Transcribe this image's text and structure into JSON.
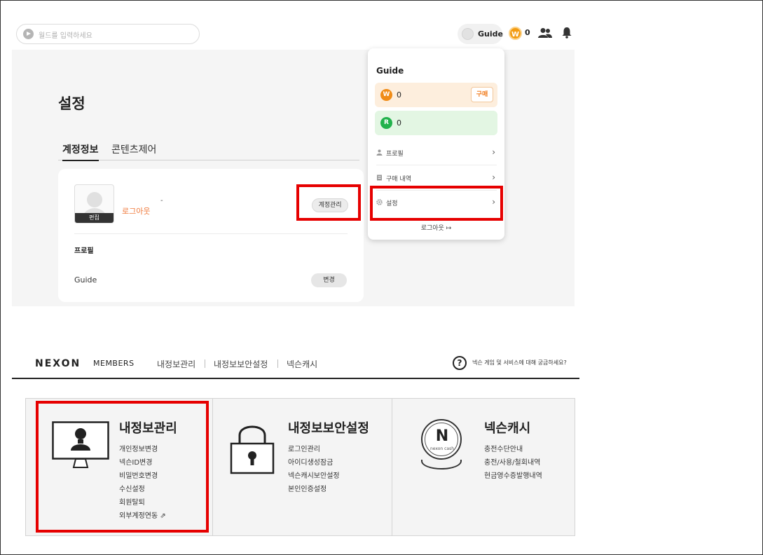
{
  "top_bar": {
    "search_placeholder": "월드를 입력하세요",
    "user_name": "Guide",
    "w_coin_letter": "W",
    "w_coin_count": "0"
  },
  "settings_page": {
    "title": "설정",
    "tabs": [
      {
        "label": "계정정보",
        "active": true
      },
      {
        "label": "콘텐츠제어",
        "active": false
      }
    ],
    "avatar_edit_label": "편집",
    "logout_label": "로그아웃",
    "dash": "-",
    "account_manage_button": "계정관리",
    "profile_section_label": "프로필",
    "profile_name": "Guide",
    "change_button": "변경"
  },
  "dropdown": {
    "name": "Guide",
    "w_letter": "W",
    "w_value": "0",
    "buy_button": "구매",
    "r_letter": "R",
    "r_value": "0",
    "items": [
      {
        "label": "프로필",
        "icon": "person-icon"
      },
      {
        "label": "구매 내역",
        "icon": "receipt-icon"
      },
      {
        "label": "설정",
        "icon": "gear-icon"
      }
    ],
    "logout": "로그아웃"
  },
  "nexon_members": {
    "logo": "NEXON",
    "members_label": "MEMBERS",
    "nav": [
      "내정보관리",
      "내정보보안설정",
      "넥슨캐시"
    ],
    "help_symbol": "?",
    "help_text": "넥슨 게임 및 서비스에 대해 궁금하세요?",
    "panels": [
      {
        "title": "내정보관리",
        "icon": "monitor-user-icon",
        "links": [
          "개인정보변경",
          "넥슨ID변경",
          "비밀번호변경",
          "수신설정",
          "회원탈퇴",
          "외부계정연동"
        ]
      },
      {
        "title": "내정보보안설정",
        "icon": "padlock-icon",
        "links": [
          "로그인관리",
          "아이디생성잠금",
          "넥슨캐시보안설정",
          "본인인증설정"
        ]
      },
      {
        "title": "넥슨캐시",
        "icon": "nexon-cash-coin-icon",
        "coin_letter": "N",
        "coin_text": "nexon cash",
        "links": [
          "충전수단안내",
          "충전/사용/철회내역",
          "현금영수증발행내역"
        ]
      }
    ]
  },
  "colors": {
    "highlight_red": "#e60000",
    "coin_orange": "#f08c17",
    "coin_green": "#22b24c",
    "logout_orange": "#f07a3c"
  }
}
